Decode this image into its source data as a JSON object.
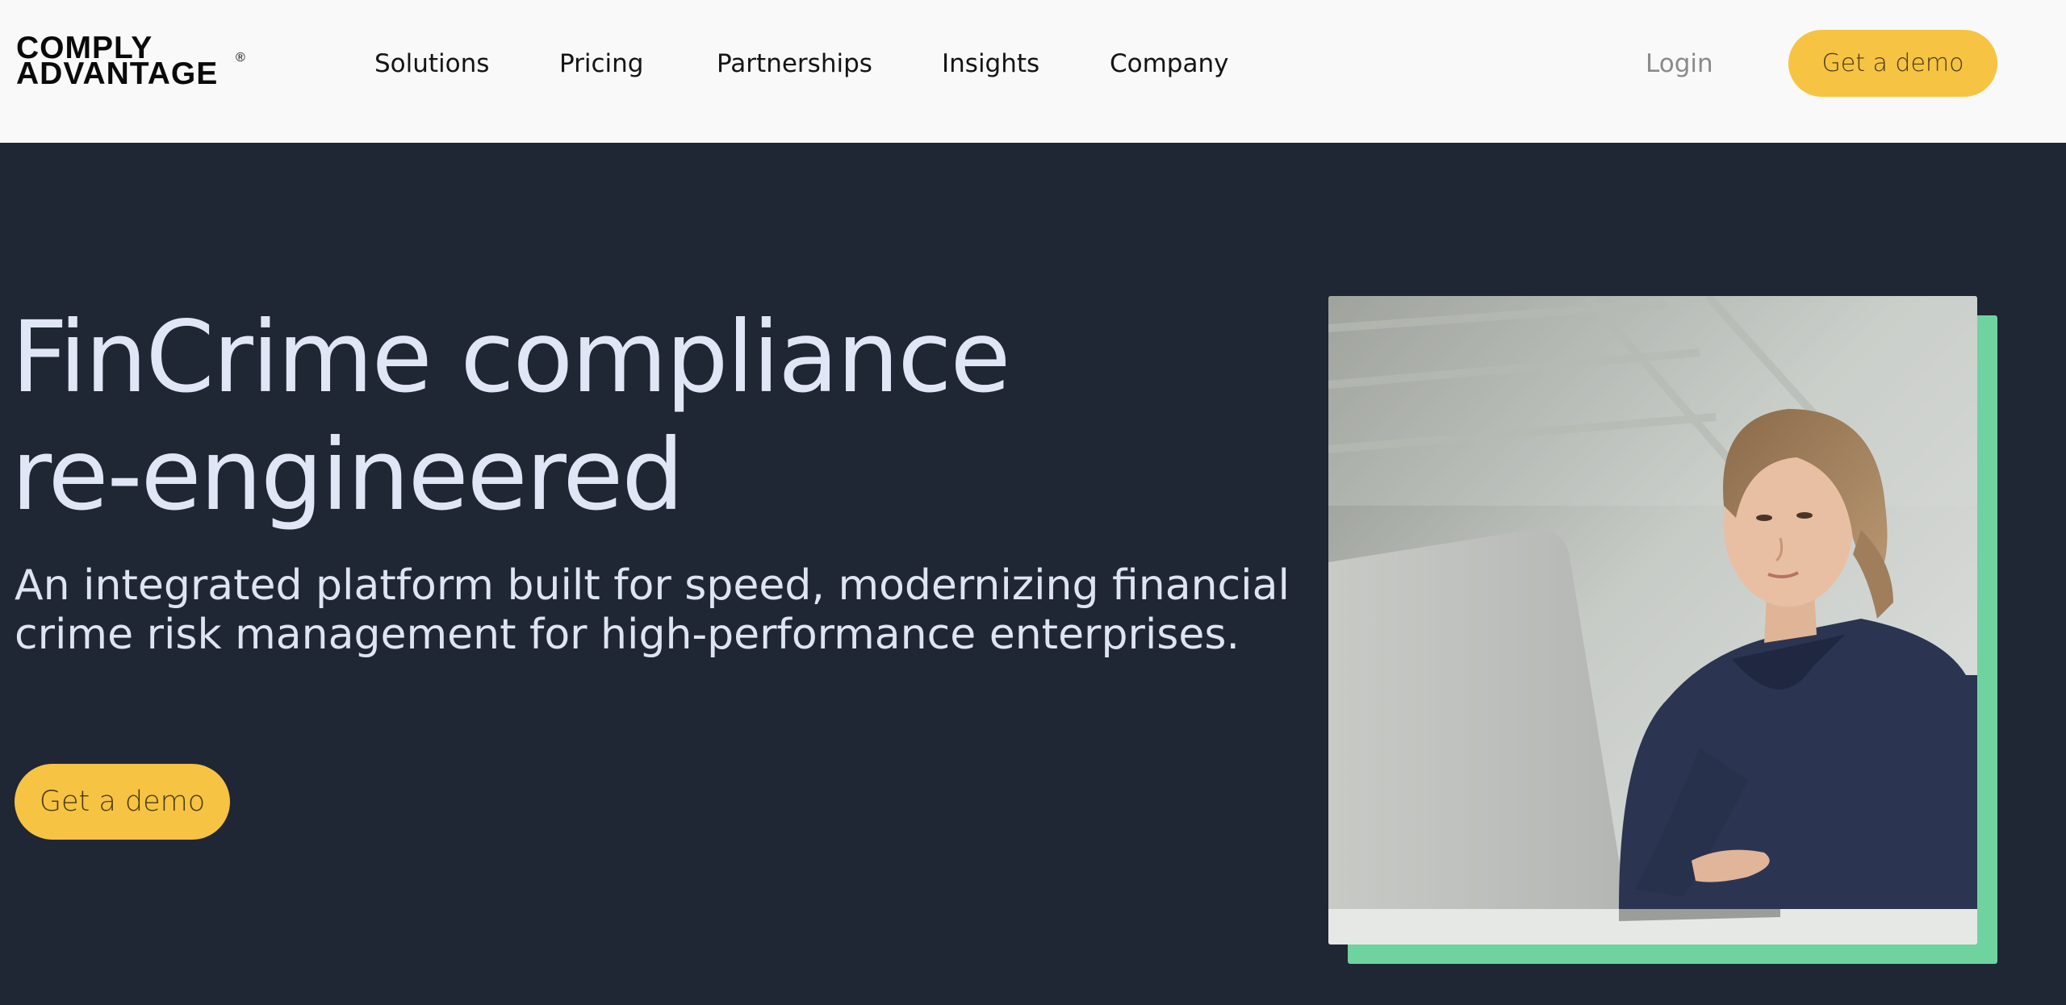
{
  "header": {
    "logo_line1": "COMPLY",
    "logo_line2": "ADVANTAGE",
    "logo_mark": "®",
    "nav": [
      {
        "label": "Solutions"
      },
      {
        "label": "Pricing"
      },
      {
        "label": "Partnerships"
      },
      {
        "label": "Insights"
      },
      {
        "label": "Company"
      }
    ],
    "login_label": "Login",
    "cta_label": "Get a demo"
  },
  "hero": {
    "title_line1": "FinCrime compliance",
    "title_line2": "re-engineered",
    "subtitle_line1": "An integrated platform built for speed, modernizing financial",
    "subtitle_line2": "crime risk management for high-performance enterprises.",
    "cta_label": "Get a demo",
    "image_alt": "Woman working on a laptop"
  },
  "colors": {
    "header_bg": "#f9f9f9",
    "hero_bg": "#1f2634",
    "accent_yellow": "#f6c343",
    "accent_green": "#6fd3a0",
    "hero_text": "#e1e6f7"
  }
}
